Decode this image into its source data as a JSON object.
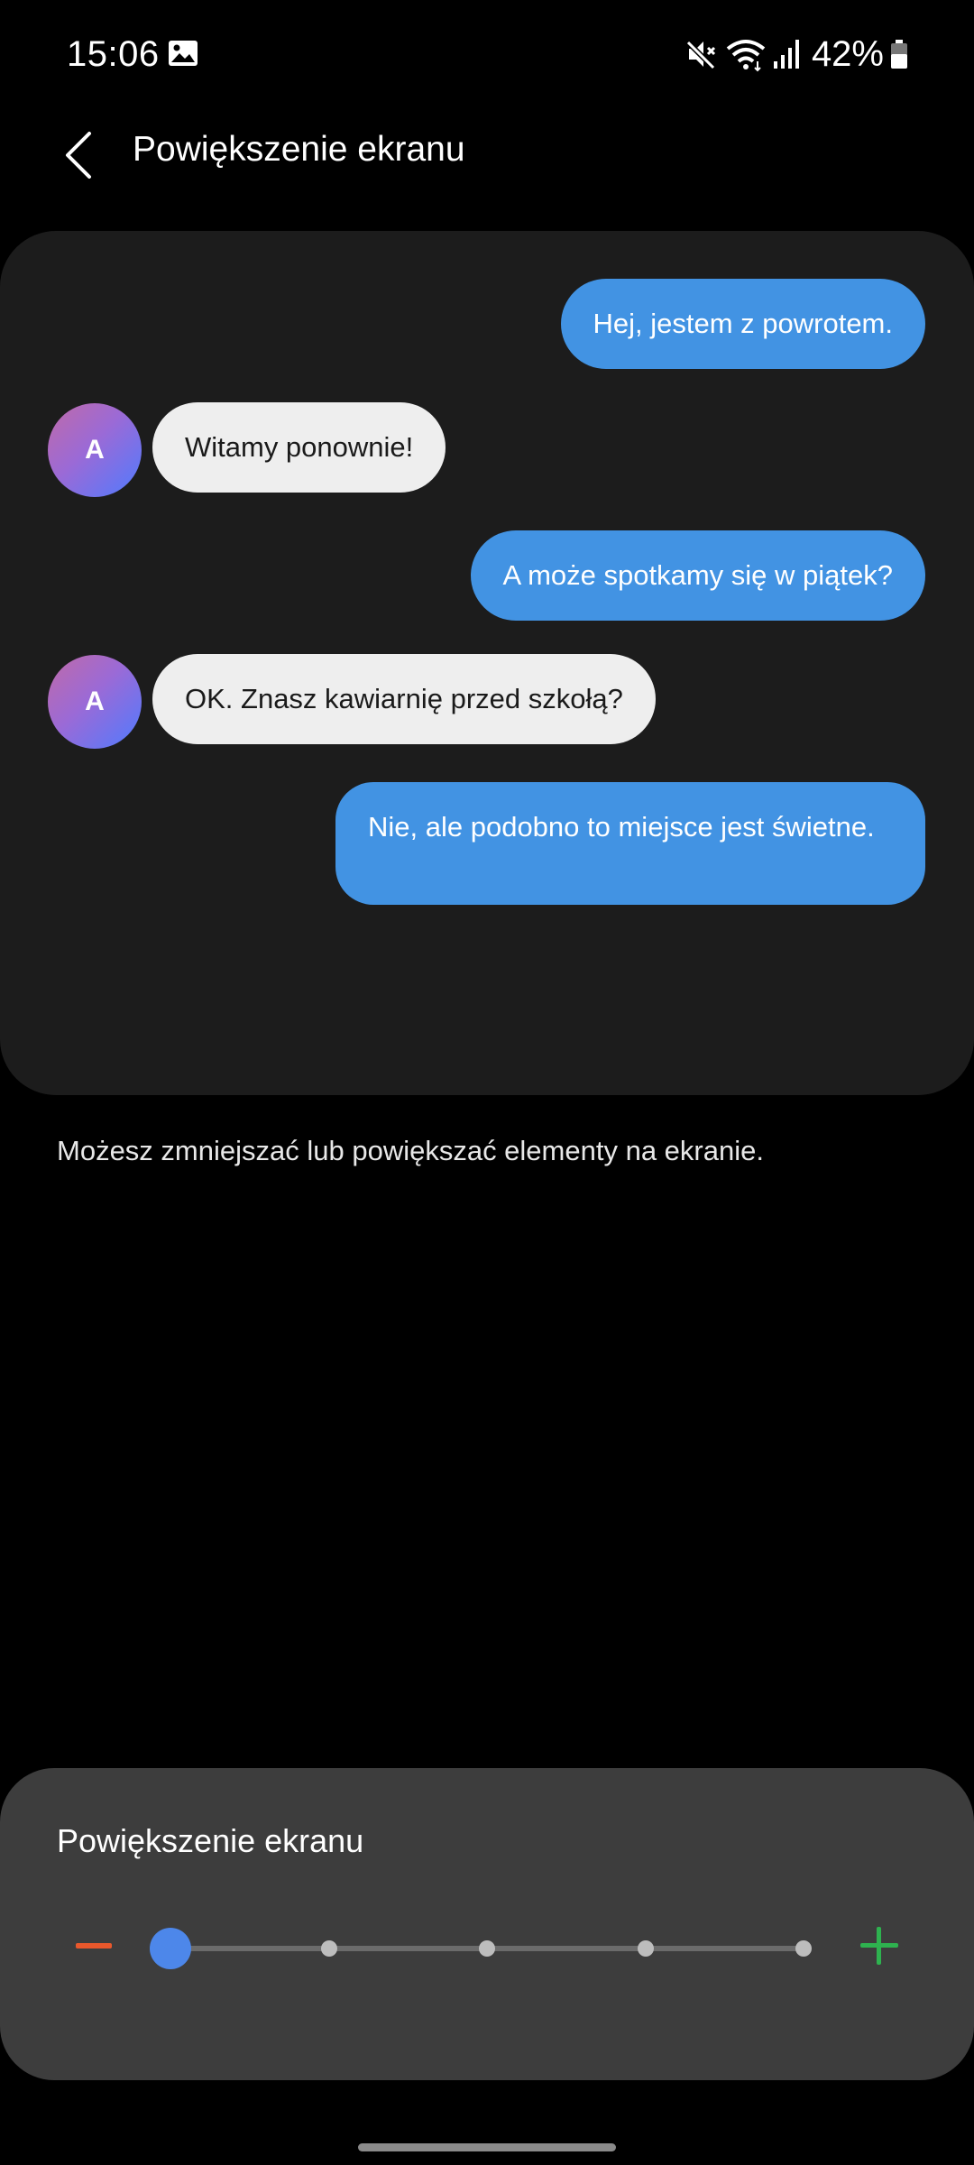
{
  "status_bar": {
    "time": "15:06",
    "battery": "42%"
  },
  "header": {
    "title": "Powiększenie ekranu"
  },
  "preview": {
    "avatar_letter": "A",
    "messages": [
      {
        "side": "out",
        "text": "Hej, jestem z powrotem."
      },
      {
        "side": "in",
        "text": "Witamy ponownie!"
      },
      {
        "side": "out",
        "text": "A może spotkamy się w piątek?"
      },
      {
        "side": "in",
        "text": "OK. Znasz kawiarnię przed szkołą?"
      },
      {
        "side": "out",
        "text": "Nie, ale podobno to miejsce jest świetne."
      }
    ]
  },
  "description": "Możesz zmniejszać lub powiększać elementy na ekranie.",
  "zoom": {
    "title": "Powiększenie ekranu",
    "steps": 5,
    "current_step": 1
  },
  "colors": {
    "outgoing_bubble": "#4293e3",
    "incoming_bubble": "#eeeeee",
    "slider_thumb": "#4d87ea",
    "minus": "#e9582c",
    "plus": "#2eb24f"
  }
}
